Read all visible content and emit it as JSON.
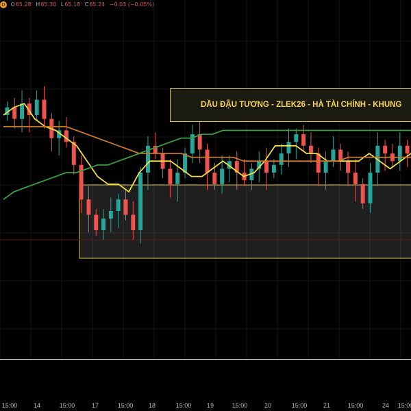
{
  "ohlc": {
    "badge": "D",
    "open_label": "O",
    "open": "65.28",
    "high_label": "H",
    "high": "65.30",
    "low_label": "L",
    "low": "65.18",
    "close_label": "C",
    "close": "65.24",
    "change": "−0.03 (−0.05%)"
  },
  "chart_data": {
    "type": "candlestick",
    "title": "DẦU ĐẬU TƯƠNG - ZLEK26 - HÀ TÀI CHÍNH - KHUNG",
    "x_tick_labels": [
      "15:00",
      "14",
      "15:00",
      "17",
      "15:00",
      "18",
      "15:00",
      "19",
      "15:00",
      "20",
      "15:00",
      "21",
      "15:00",
      "24",
      "15:00"
    ],
    "range_box_color": "#e8c84a",
    "ma_series": [
      {
        "color": "#f2e040",
        "values": [
          70,
          72,
          73,
          69,
          67,
          66,
          64,
          62,
          58,
          54,
          52,
          52,
          50,
          55,
          58,
          58,
          58,
          56,
          54,
          54,
          56,
          58,
          56,
          54,
          55,
          58,
          62,
          62,
          62,
          60,
          60,
          58,
          58,
          58,
          58,
          60,
          58,
          56,
          58,
          60
        ]
      },
      {
        "color": "#c8782a",
        "values": [
          67,
          67,
          67,
          67,
          67,
          67,
          67,
          66,
          65,
          64,
          63,
          62,
          61,
          60,
          60,
          60,
          60,
          60,
          59,
          59,
          59,
          59,
          59,
          58,
          58,
          58,
          58,
          58,
          58,
          58,
          58,
          58,
          58,
          59,
          59,
          59,
          59,
          59,
          59,
          59
        ]
      },
      {
        "color": "#3aa040",
        "values": [
          48,
          50,
          51,
          52,
          53,
          54,
          55,
          55,
          56,
          57,
          57,
          58,
          59,
          60,
          61,
          62,
          63,
          64,
          64,
          65,
          65,
          66,
          66,
          66,
          66,
          66,
          66,
          66,
          66,
          66,
          66,
          66,
          66,
          66,
          66,
          66,
          66,
          66,
          66,
          66
        ]
      }
    ],
    "candles": [
      {
        "o": 70,
        "c": 72
      },
      {
        "o": 72,
        "c": 69
      },
      {
        "o": 69,
        "c": 73
      },
      {
        "o": 73,
        "c": 70
      },
      {
        "o": 70,
        "c": 74
      },
      {
        "o": 74,
        "c": 69
      },
      {
        "o": 69,
        "c": 64
      },
      {
        "o": 64,
        "c": 66
      },
      {
        "o": 66,
        "c": 63
      },
      {
        "o": 63,
        "c": 57
      },
      {
        "o": 57,
        "c": 48
      },
      {
        "o": 48,
        "c": 44
      },
      {
        "o": 44,
        "c": 40
      },
      {
        "o": 40,
        "c": 43
      },
      {
        "o": 43,
        "c": 45
      },
      {
        "o": 45,
        "c": 48
      },
      {
        "o": 48,
        "c": 44
      },
      {
        "o": 44,
        "c": 40
      },
      {
        "o": 40,
        "c": 55
      },
      {
        "o": 55,
        "c": 62
      },
      {
        "o": 62,
        "c": 60
      },
      {
        "o": 60,
        "c": 56
      },
      {
        "o": 56,
        "c": 52
      },
      {
        "o": 52,
        "c": 55
      },
      {
        "o": 55,
        "c": 60
      },
      {
        "o": 60,
        "c": 65
      },
      {
        "o": 65,
        "c": 61
      },
      {
        "o": 61,
        "c": 55
      },
      {
        "o": 55,
        "c": 52
      },
      {
        "o": 52,
        "c": 56
      },
      {
        "o": 56,
        "c": 58
      },
      {
        "o": 58,
        "c": 55
      },
      {
        "o": 55,
        "c": 53
      },
      {
        "o": 53,
        "c": 56
      },
      {
        "o": 56,
        "c": 58
      },
      {
        "o": 58,
        "c": 55
      },
      {
        "o": 55,
        "c": 57
      },
      {
        "o": 57,
        "c": 60
      },
      {
        "o": 60,
        "c": 63
      },
      {
        "o": 63,
        "c": 65
      },
      {
        "o": 65,
        "c": 62
      },
      {
        "o": 62,
        "c": 60
      },
      {
        "o": 60,
        "c": 55
      },
      {
        "o": 55,
        "c": 58
      },
      {
        "o": 58,
        "c": 61
      },
      {
        "o": 61,
        "c": 58
      },
      {
        "o": 58,
        "c": 55
      },
      {
        "o": 55,
        "c": 52
      },
      {
        "o": 52,
        "c": 47
      },
      {
        "o": 47,
        "c": 55
      },
      {
        "o": 55,
        "c": 62
      },
      {
        "o": 62,
        "c": 60
      },
      {
        "o": 60,
        "c": 58
      },
      {
        "o": 58,
        "c": 62
      },
      {
        "o": 62,
        "c": 60
      }
    ]
  }
}
